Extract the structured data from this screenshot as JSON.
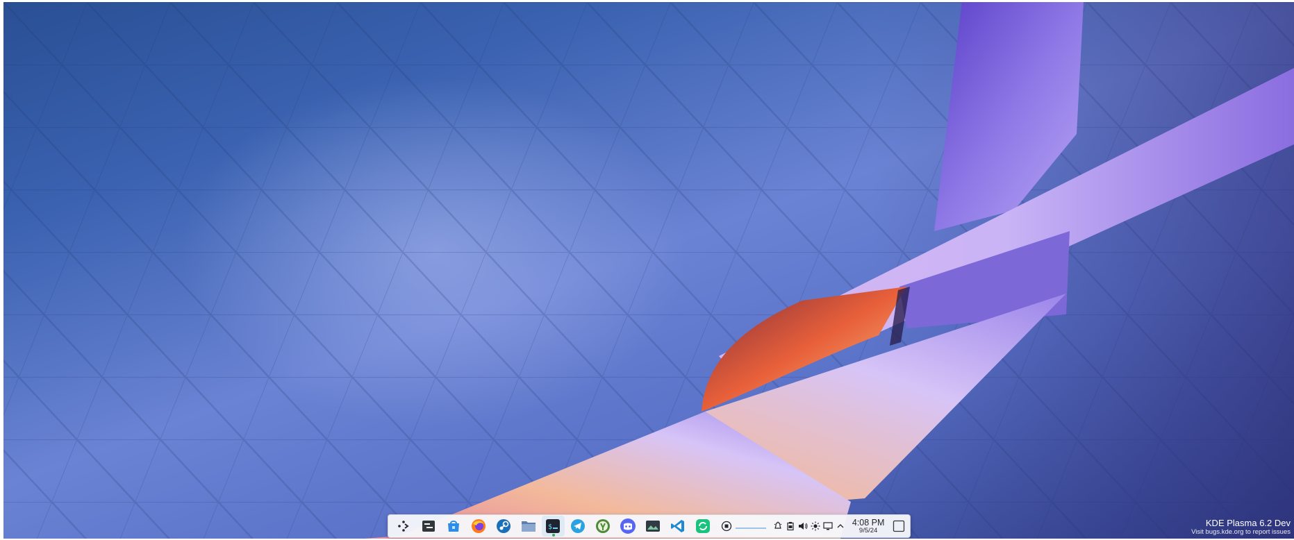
{
  "wallpaper": {
    "description_name": "kde-plasma-6-ribbon-wallpaper",
    "colors": {
      "sky_top": "#2a4f95",
      "sky_mid": "#6b83d4",
      "ribbon_light": "#c8b8ff",
      "ribbon_dark": "#6a4fd0",
      "ribbon_warm": "#f2a07a"
    }
  },
  "taskbar": {
    "launcher": {
      "icon": "application-launcher-icon"
    },
    "apps": [
      {
        "name": "overview",
        "icon": "overview-icon",
        "active": false
      },
      {
        "name": "store",
        "icon": "store-icon",
        "active": false
      },
      {
        "name": "firefox",
        "icon": "firefox-icon",
        "active": false
      },
      {
        "name": "steam",
        "icon": "steam-icon",
        "active": false
      },
      {
        "name": "file-manager",
        "icon": "folder-icon",
        "active": false
      },
      {
        "name": "terminal",
        "icon": "terminal-icon",
        "active": true,
        "label": "$_"
      },
      {
        "name": "telegram",
        "icon": "telegram-icon",
        "active": false
      },
      {
        "name": "discover",
        "icon": "monitor-app-icon",
        "active": false
      },
      {
        "name": "discord",
        "icon": "discord-icon",
        "active": false
      },
      {
        "name": "image-viewer",
        "icon": "image-viewer-icon",
        "active": false
      },
      {
        "name": "vscode",
        "icon": "vscode-icon",
        "active": false
      },
      {
        "name": "sync-app",
        "icon": "sync-icon",
        "active": false
      }
    ],
    "tray": {
      "items": [
        "media-stop-icon",
        "notifications-icon",
        "clipboard-icon",
        "volume-icon",
        "brightness-icon",
        "display-icon",
        "chevron-up-icon"
      ],
      "media_progress": 0.0
    },
    "clock": {
      "time": "4:08 PM",
      "date": "9/5/24"
    },
    "show_desktop_icon": "show-desktop-icon"
  },
  "watermark": {
    "title": "KDE Plasma 6.2 Dev",
    "subtitle": "Visit bugs.kde.org to report issues"
  }
}
